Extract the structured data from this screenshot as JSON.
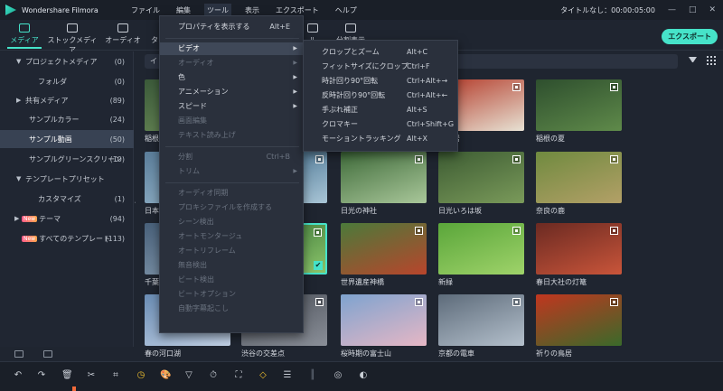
{
  "app": {
    "name": "Wondershare Filmora",
    "project_status": "タイトルなし：00:00:05:00"
  },
  "menubar": {
    "items": [
      "ファイル",
      "編集",
      "ツール",
      "表示",
      "エクスポート",
      "ヘルプ"
    ],
    "active": "ツール"
  },
  "window_controls": [
    "—",
    "□",
    "✕"
  ],
  "tabs": [
    {
      "label": "メディア",
      "active": true
    },
    {
      "label": "ストックメディア"
    },
    {
      "label": "オーディオ"
    },
    {
      "label": "タ"
    },
    {
      "label": "ル"
    },
    {
      "label": "分割表示"
    }
  ],
  "export_button": "エクスポート",
  "sidebar": {
    "items": [
      {
        "label": "プロジェクトメディア",
        "count": "(0)",
        "arrow": "▼"
      },
      {
        "label": "フォルダ",
        "count": "(0)"
      },
      {
        "label": "共有メディア",
        "count": "(89)",
        "arrow": "▶"
      },
      {
        "label": "サンプルカラー",
        "count": "(24)"
      },
      {
        "label": "サンプル動画",
        "count": "(50)",
        "selected": true
      },
      {
        "label": "サンプルグリーンスクリーン",
        "count": "(10)"
      },
      {
        "label": "テンプレートプリセット",
        "count": "",
        "arrow": "▼"
      },
      {
        "label": "カスタマイズ",
        "count": "(1)"
      },
      {
        "label": "テーマ",
        "count": "(94)",
        "arrow": "▶",
        "badge": "New"
      },
      {
        "label": "すべてのテンプレート",
        "count": "(113)",
        "badge": "New"
      }
    ]
  },
  "search": {
    "value": "イ"
  },
  "media": {
    "thumbnails": [
      {
        "caption": "稲根",
        "row": 0,
        "col": 0,
        "colors": [
          "#3b5a3a",
          "#6f8f5a"
        ]
      },
      {
        "caption": "の鳥居",
        "row": 0,
        "col": 3,
        "colors": [
          "#b43b2a",
          "#e7e2d4"
        ]
      },
      {
        "caption": "稲根の夏",
        "row": 0,
        "col": 4,
        "colors": [
          "#2e4f2e",
          "#5f8a4a"
        ]
      },
      {
        "caption": "日本",
        "row": 1,
        "col": 0,
        "colors": [
          "#5a7d9a",
          "#9bbbd0"
        ]
      },
      {
        "caption": "日光の神社",
        "row": 1,
        "col": 2,
        "colors": [
          "#3f6b3a",
          "#a9c79a"
        ]
      },
      {
        "caption": "日光いろは坂",
        "row": 1,
        "col": 3,
        "colors": [
          "#3d5c33",
          "#7a9a5a"
        ]
      },
      {
        "caption": "奈良の鹿",
        "row": 1,
        "col": 4,
        "colors": [
          "#6f8a3f",
          "#b3a067"
        ]
      },
      {
        "caption": "千葉",
        "row": 2,
        "col": 0,
        "colors": [
          "#48607a",
          "#8aa0b4"
        ]
      },
      {
        "caption": "世界遺産神橋",
        "row": 2,
        "col": 2,
        "colors": [
          "#4b7a3a",
          "#b8452c"
        ]
      },
      {
        "caption": "新緑",
        "row": 2,
        "col": 3,
        "colors": [
          "#5aa63a",
          "#9fd36a"
        ]
      },
      {
        "caption": "春日大社の灯篭",
        "row": 2,
        "col": 4,
        "colors": [
          "#6b2a22",
          "#c9553a"
        ]
      },
      {
        "caption": "春の河口湖",
        "row": 3,
        "col": 0,
        "colors": [
          "#6a8db5",
          "#c3d2e6"
        ]
      },
      {
        "caption": "渋谷の交差点",
        "row": 3,
        "col": 1,
        "colors": [
          "#4a4f58",
          "#8a8f98"
        ]
      },
      {
        "caption": "桜時期の富士山",
        "row": 3,
        "col": 2,
        "colors": [
          "#7ea3cf",
          "#e6b7c5"
        ]
      },
      {
        "caption": "京都の電車",
        "row": 3,
        "col": 3,
        "colors": [
          "#5d6b7a",
          "#b4c0cc"
        ]
      },
      {
        "caption": "祈りの鳥居",
        "row": 3,
        "col": 4,
        "colors": [
          "#c1361f",
          "#3a6a2a"
        ]
      },
      {
        "caption": "",
        "row": 2,
        "col": 1,
        "colors": [
          "#3f7a3a",
          "#8ac36a"
        ],
        "selected": true
      },
      {
        "caption": "",
        "row": 1,
        "col": 1,
        "colors": [
          "#3d6a8a",
          "#a9c5d6"
        ]
      }
    ]
  },
  "tools_menu": {
    "items": [
      {
        "label": "プロパティを表示する",
        "shortcut": "Alt+E"
      },
      {
        "separator": true
      },
      {
        "label": "ビデオ",
        "submenu": true,
        "highlighted": true
      },
      {
        "label": "オーディオ",
        "submenu": true,
        "disabled": true
      },
      {
        "label": "色",
        "submenu": true
      },
      {
        "label": "アニメーション",
        "submenu": true
      },
      {
        "label": "スピード",
        "submenu": true
      },
      {
        "label": "画面編集",
        "disabled": true
      },
      {
        "label": "テキスト読み上げ",
        "disabled": true
      },
      {
        "separator": true
      },
      {
        "label": "分割",
        "shortcut": "Ctrl+B",
        "disabled": true
      },
      {
        "label": "トリム",
        "submenu": true,
        "disabled": true
      },
      {
        "separator": true
      },
      {
        "label": "オーディオ同期",
        "disabled": true
      },
      {
        "label": "プロキシファイルを作成する",
        "disabled": true
      },
      {
        "label": "シーン検出",
        "disabled": true
      },
      {
        "label": "オートモンタージュ",
        "disabled": true
      },
      {
        "label": "オートリフレーム",
        "disabled": true
      },
      {
        "label": "無音検出",
        "disabled": true
      },
      {
        "label": "ビート検出",
        "disabled": true
      },
      {
        "label": "ビートオプション",
        "disabled": true
      },
      {
        "label": "自動字幕起こし",
        "disabled": true
      }
    ]
  },
  "video_submenu": {
    "items": [
      {
        "label": "クロップとズーム",
        "shortcut": "Alt+C"
      },
      {
        "label": "フィットサイズにクロップ",
        "shortcut": "Ctrl+F"
      },
      {
        "label": "時計回り90°回転",
        "shortcut": "Ctrl+Alt+→"
      },
      {
        "label": "反時計回り90°回転",
        "shortcut": "Ctrl+Alt+←"
      },
      {
        "label": "手ぶれ補正",
        "shortcut": "Alt+S"
      },
      {
        "label": "クロマキー",
        "shortcut": "Ctrl+Shift+G"
      },
      {
        "label": "モーショントラッキング",
        "shortcut": "Alt+X"
      }
    ]
  },
  "toolbar": {
    "icons": [
      "↶",
      "↷",
      "🗑",
      "✂",
      "⌗",
      "◷",
      "🎨",
      "▽",
      "⏱",
      "⛶",
      "◇",
      "☰",
      "║",
      "◎",
      "◐"
    ]
  }
}
